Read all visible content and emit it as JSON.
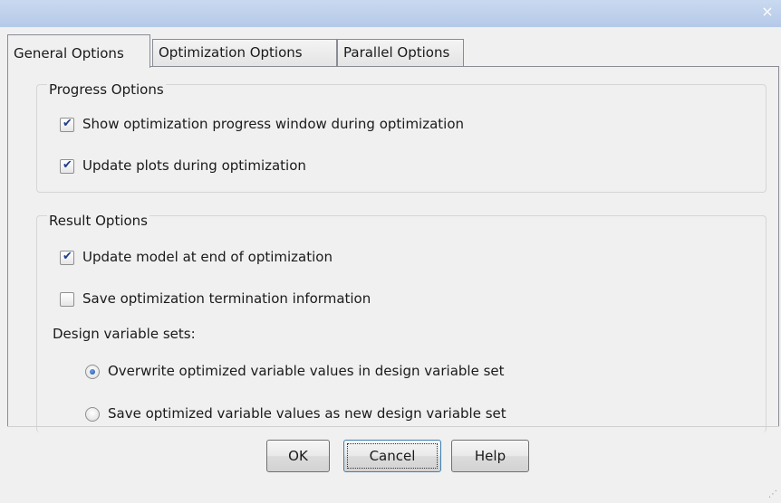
{
  "window": {
    "close_glyph": "×"
  },
  "tabs": [
    {
      "label": "General Options",
      "active": true
    },
    {
      "label": "Optimization Options",
      "active": false
    },
    {
      "label": "Parallel Options",
      "active": false
    }
  ],
  "progress_options": {
    "title": "Progress Options",
    "items": [
      {
        "label": "Show optimization progress window during optimization",
        "checked": true
      },
      {
        "label": "Update plots during optimization",
        "checked": true
      }
    ]
  },
  "result_options": {
    "title": "Result Options",
    "items": [
      {
        "label": "Update model at end of optimization",
        "checked": true
      },
      {
        "label": "Save optimization termination information",
        "checked": false
      }
    ],
    "design_variable_sets_label": "Design variable sets:",
    "radios": [
      {
        "label": "Overwrite optimized variable values in design variable set",
        "selected": true
      },
      {
        "label": "Save optimized variable values as new design variable set",
        "selected": false
      }
    ]
  },
  "buttons": {
    "ok": "OK",
    "cancel": "Cancel",
    "help": "Help"
  },
  "glyphs": {
    "check": "✔",
    "grip": "⋰"
  }
}
